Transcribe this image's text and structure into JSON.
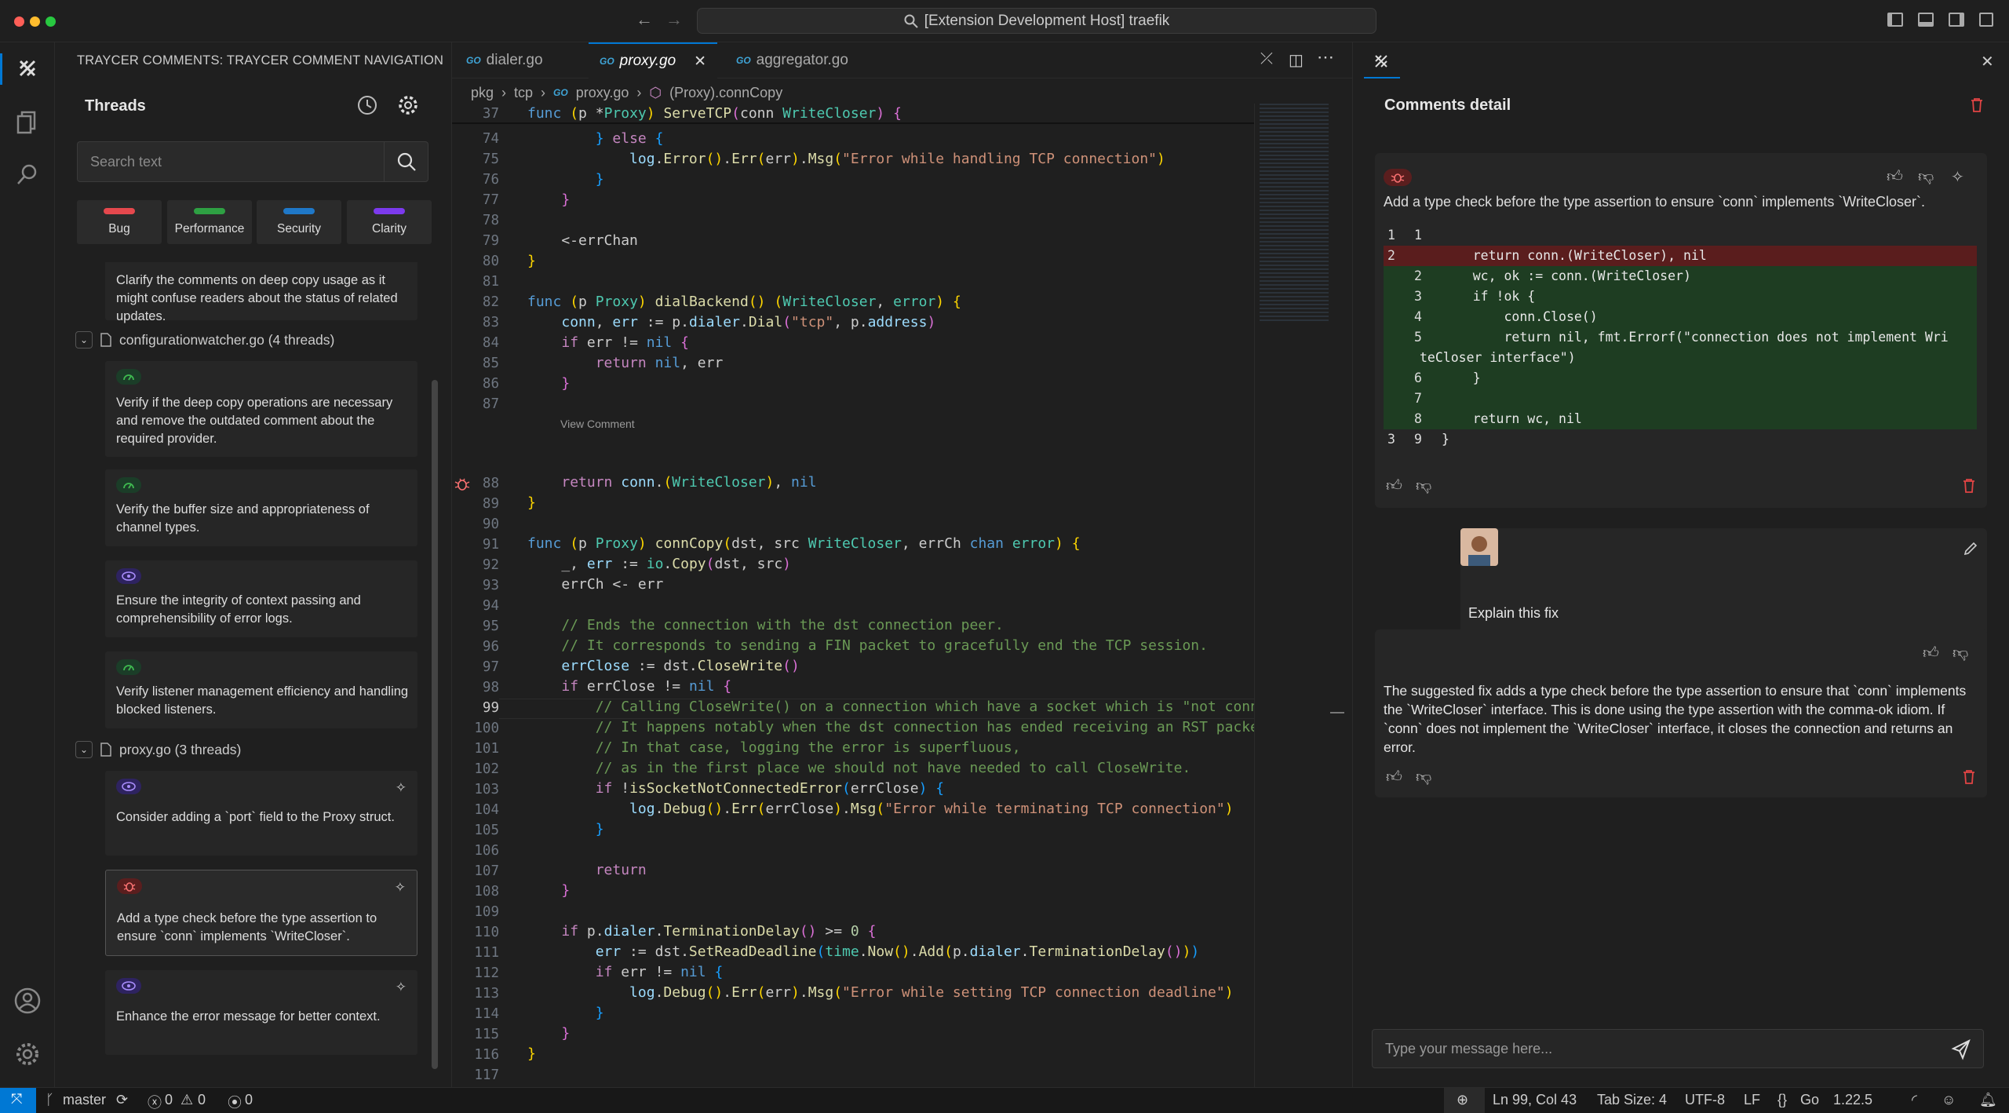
{
  "window": {
    "title": "[Extension Development Host] traefik"
  },
  "sidebar": {
    "header": "TRAYCER COMMENTS: TRAYCER COMMENT NAVIGATION",
    "threads_title": "Threads",
    "search_placeholder": "Search text",
    "categories": [
      {
        "label": "Bug",
        "color": "#e5484d"
      },
      {
        "label": "Performance",
        "color": "#2ea043"
      },
      {
        "label": "Security",
        "color": "#1f78c8"
      },
      {
        "label": "Clarity",
        "color": "#7c3aed"
      }
    ],
    "top_card_text": "Clarify the comments on deep copy usage as it might confuse readers about the status of related updates.",
    "file1": "configurationwatcher.go (4 threads)",
    "file1_cards": [
      "Verify if the deep copy operations are necessary and remove the outdated comment about the required provider.",
      "Verify the buffer size and appropriateness of channel types.",
      "Ensure the integrity of context passing and comprehensibility of error logs.",
      "Verify listener management efficiency and handling blocked listeners."
    ],
    "file2": "proxy.go (3 threads)",
    "file2_cards": [
      "Consider adding a `port` field to the Proxy struct.",
      "Add a type check before the type assertion to ensure `conn` implements `WriteCloser`.",
      "Enhance the error message for better context."
    ]
  },
  "editor": {
    "tabs": [
      "dialer.go",
      "proxy.go",
      "aggregator.go"
    ],
    "breadcrumb": [
      "pkg",
      "tcp",
      "proxy.go",
      "(Proxy).connCopy"
    ],
    "view_comment": "View Comment"
  },
  "comments": {
    "title": "Comments detail",
    "suggestion": "Add a type check before the type assertion to ensure `conn` implements `WriteCloser`.",
    "diff": [
      {
        "a": "1",
        "b": "1",
        "code": "",
        "kind": "ctx"
      },
      {
        "a": "2",
        "b": "",
        "code": "    return conn.(WriteCloser), nil",
        "kind": "rm"
      },
      {
        "a": "",
        "b": "2",
        "code": "    wc, ok := conn.(WriteCloser)",
        "kind": "ad"
      },
      {
        "a": "",
        "b": "3",
        "code": "    if !ok {",
        "kind": "ad"
      },
      {
        "a": "",
        "b": "4",
        "code": "        conn.Close()",
        "kind": "ad"
      },
      {
        "a": "",
        "b": "5",
        "code": "        return nil, fmt.Errorf(\"connection does not implement Wri",
        "kind": "ad"
      },
      {
        "a": "",
        "b": "",
        "code": "teCloser interface\")",
        "kind": "ad",
        "wrap": true
      },
      {
        "a": "",
        "b": "6",
        "code": "    }",
        "kind": "ad"
      },
      {
        "a": "",
        "b": "7",
        "code": "",
        "kind": "ad"
      },
      {
        "a": "",
        "b": "8",
        "code": "    return wc, nil",
        "kind": "ad"
      },
      {
        "a": "3",
        "b": "9",
        "code": "}",
        "kind": "ctx"
      }
    ],
    "user_message": "Explain this fix",
    "reply": "The suggested fix adds a type check before the type assertion to ensure that `conn` implements the `WriteCloser` interface. This is done using the type assertion with the comma-ok idiom. If `conn` does not implement the `WriteCloser` interface, it closes the connection and returns an error.",
    "input_placeholder": "Type your message here..."
  },
  "status": {
    "branch": "master",
    "errors": "0",
    "warnings": "0",
    "ports": "0",
    "position": "Ln 99, Col 43",
    "tab_size": "Tab Size: 4",
    "encoding": "UTF-8",
    "eol": "LF",
    "language": "Go",
    "go_version": "1.22.5"
  }
}
